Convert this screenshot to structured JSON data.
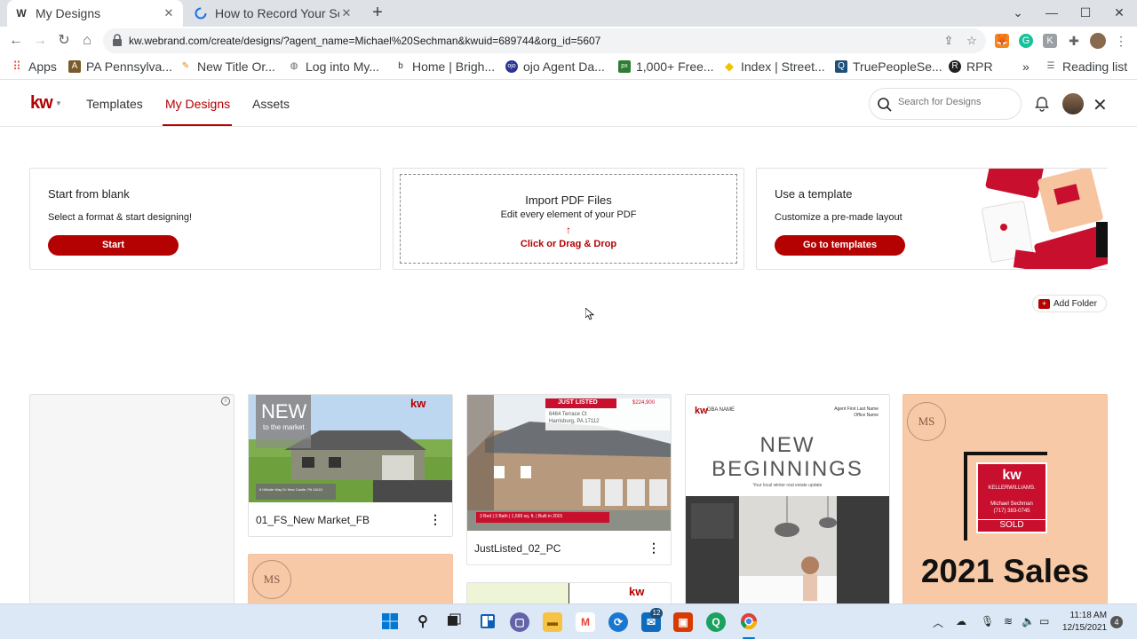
{
  "browser": {
    "tabs": [
      {
        "title": "My Designs",
        "active": true
      },
      {
        "title": "How to Record Your Sc",
        "active": false
      }
    ],
    "url": "kw.webrand.com/create/designs/?agent_name=Michael%20Sechman&kwuid=689744&org_id=5607",
    "bookmarks": [
      {
        "label": "Apps",
        "icon": "apps-grid-icon"
      },
      {
        "label": "PA Pennsylva...",
        "icon": "pa-icon"
      },
      {
        "label": "New Title Or...",
        "icon": "pencil-icon"
      },
      {
        "label": "Log into My...",
        "icon": "globe-icon"
      },
      {
        "label": "Home | Brigh...",
        "icon": "b-icon"
      },
      {
        "label": "ojo Agent Da...",
        "icon": "ojo-icon"
      },
      {
        "label": "1,000+ Free...",
        "icon": "px-icon"
      },
      {
        "label": "Index | Street...",
        "icon": "diamond-icon"
      },
      {
        "label": "TruePeopleSe...",
        "icon": "q-icon"
      },
      {
        "label": "RPR",
        "icon": "rpr-icon"
      }
    ],
    "overflow": "»",
    "reading_list": "Reading list"
  },
  "app": {
    "logo": "kw",
    "nav": [
      {
        "label": "Templates",
        "active": false
      },
      {
        "label": "My Designs",
        "active": true
      },
      {
        "label": "Assets",
        "active": false
      }
    ],
    "search_placeholder": "Search for Designs"
  },
  "cards": {
    "blank": {
      "title": "Start from blank",
      "subtitle": "Select a format & start designing!",
      "button": "Start"
    },
    "import": {
      "title": "Import PDF Files",
      "subtitle": "Edit every element of your PDF",
      "arrow": "↑",
      "cta": "Click or Drag & Drop"
    },
    "template": {
      "title": "Use a template",
      "subtitle": "Customize a pre-made layout",
      "button": "Go to templates"
    }
  },
  "add_folder": "Add Folder",
  "designs": [
    {
      "name": "01_FS_New Market_FB",
      "thumb": {
        "headline": "NEW",
        "sub": "to the market",
        "brand": "kw",
        "caption": "6 Hillside Way Dr  New Castle, PA 16101"
      }
    },
    {
      "name": "JustListed_02_PC",
      "thumb": {
        "badge": "JUST LISTED",
        "price": "$224,900",
        "address1": "6464 Terrace Ct",
        "address2": "Harrisburg, PA 17112",
        "stats": "3 Bed | 3 Bath | 1,599 sq. ft. | Built in 2001"
      }
    },
    {
      "name": "",
      "thumb": {
        "brand": "kw",
        "dba": "DBA NAME",
        "agent1": "Agent First Last Name",
        "agent2": "Office Name",
        "headline1": "NEW",
        "headline2": "BEGINNINGS",
        "tagline": "Your local winter real estate update"
      }
    },
    {
      "name": "",
      "thumb": {
        "monogram": "MS",
        "brand": "kw",
        "brand_sub": "KELLERWILLIAMS.",
        "agent": "Michael Sechman",
        "phone": "(717) 383-0745",
        "sold": "SOLD",
        "headline": "2021 Sales"
      }
    }
  ],
  "second_row": [
    {
      "monogram": "MS"
    },
    {
      "brand": "kw"
    }
  ],
  "taskbar": {
    "clock_time": "11:18 AM",
    "clock_date": "12/15/2021",
    "notifications": "4",
    "badge": "12"
  }
}
